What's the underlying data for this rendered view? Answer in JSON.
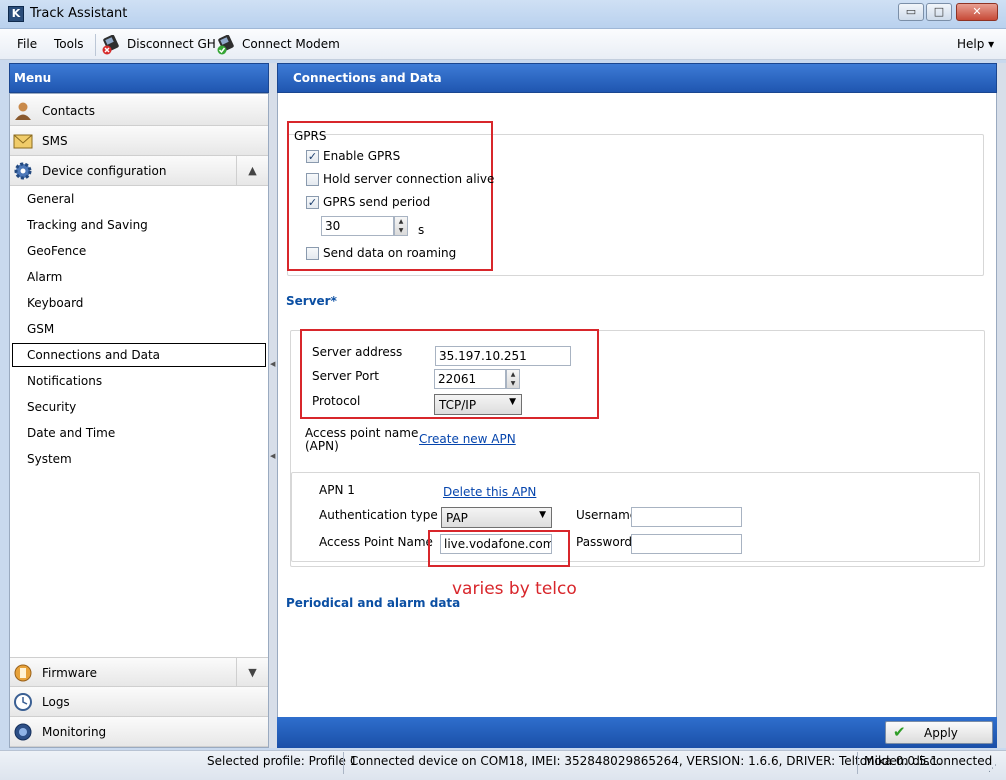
{
  "window": {
    "title": "Track Assistant",
    "controls": {
      "minimize": "▭",
      "maximize": "□",
      "close": "✕"
    }
  },
  "menubar": {
    "file": "File",
    "tools": "Tools",
    "disconnect_gh": "Disconnect GH",
    "connect_modem": "Connect Modem",
    "help": "Help ▾"
  },
  "sidebar": {
    "header": "Menu",
    "contacts": "Contacts",
    "sms": "SMS",
    "device_configuration": "Device configuration",
    "sub_items": [
      "General",
      "Tracking and Saving",
      "GeoFence",
      "Alarm",
      "Keyboard",
      "GSM",
      "Connections and Data",
      "Notifications",
      "Security",
      "Date and Time",
      "System"
    ],
    "active_item": "Connections and Data",
    "firmware": "Firmware",
    "logs": "Logs",
    "monitoring": "Monitoring"
  },
  "main": {
    "header": "Connections and Data",
    "gprs": {
      "title": "GPRS",
      "enable_gprs": {
        "label": "Enable GPRS",
        "checked": true
      },
      "hold_connection": {
        "label": "Hold server connection alive",
        "checked": false
      },
      "send_period": {
        "label": "GPRS send period",
        "checked": true
      },
      "period_value": "30",
      "period_unit": "s",
      "roaming": {
        "label": "Send data on roaming",
        "checked": false
      }
    },
    "server": {
      "title": "Server*",
      "address_label": "Server address",
      "address_value": "35.197.10.251",
      "port_label": "Server Port",
      "port_value": "22061",
      "protocol_label": "Protocol",
      "protocol_value": "TCP/IP",
      "apn_label": "Access point name\n(APN)",
      "create_apn": "Create new APN"
    },
    "apn1": {
      "title": "APN 1",
      "delete_link": "Delete this APN",
      "auth_label": "Authentication type",
      "auth_value": "PAP",
      "apn_name_label": "Access Point Name",
      "apn_name_value": "live.vodafone.com",
      "username_label": "Username",
      "username_value": "",
      "password_label": "Password",
      "password_value": ""
    },
    "annotation": "varies by telco",
    "periodical_title": "Periodical and alarm data",
    "apply": "Apply"
  },
  "statusbar": {
    "profile": "Selected profile: Profile 1",
    "device": "Connected device on COM18, IMEI: 352848029865264, VERSION: 1.6.6, DRIVER: Teltonika 0.0.5.1.",
    "modem": "Modem disconnected"
  },
  "colors": {
    "header_blue": "#1f56b0",
    "highlight_red": "#d8262b",
    "link_blue": "#0645ad"
  }
}
